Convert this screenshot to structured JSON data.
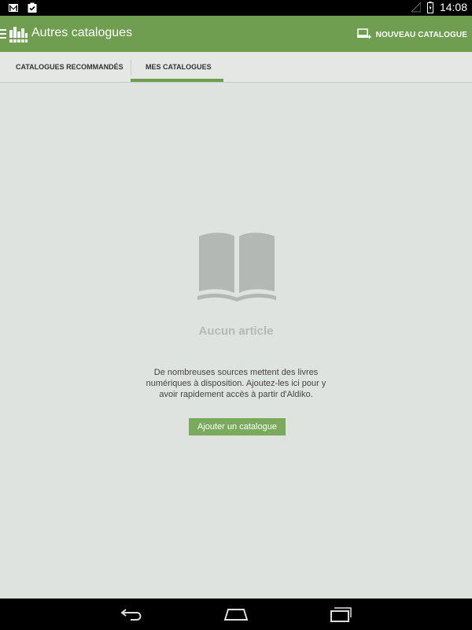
{
  "status_bar": {
    "time": "14:08",
    "icons": [
      "gmail-icon",
      "clipboard-check-icon",
      "signal-icon",
      "battery-icon"
    ]
  },
  "action_bar": {
    "title": "Autres catalogues",
    "new_catalogue_label": "NOUVEAU CATALOGUE"
  },
  "tabs": [
    {
      "label": "CATALOGUES RECOMMANDÉS",
      "selected": false
    },
    {
      "label": "MES CATALOGUES",
      "selected": true
    }
  ],
  "empty_state": {
    "title": "Aucun article",
    "description": "De nombreuses sources mettent des livres numériques à disposition. Ajoutez-les ici pour y avoir rapidement accès à partir d'Aldiko.",
    "button_label": "Ajouter un catalogue"
  },
  "nav_bar": {
    "icons": [
      "back-icon",
      "home-icon",
      "recents-icon"
    ]
  },
  "colors": {
    "accent": "#6f9e51",
    "button": "#7aab5c",
    "background": "#dfe3df"
  }
}
